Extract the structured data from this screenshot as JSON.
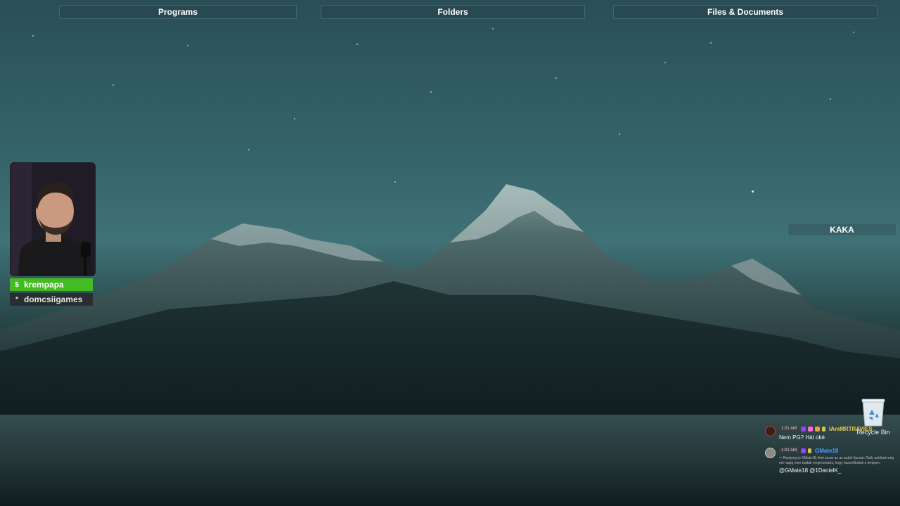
{
  "fences": {
    "programs": "Programs",
    "folders": "Folders",
    "files": "Files & Documents",
    "kaka": "KAKA"
  },
  "stream": {
    "main_streamer": "krempapa",
    "main_icon": "$",
    "co_streamer": "domcsiigames",
    "co_icon": "*",
    "highlight_color": "#44bb22"
  },
  "desktop_icons": {
    "recycle_bin": "Recycle Bin"
  },
  "chat": {
    "messages": [
      {
        "time": "1:01 AM",
        "user": "IAmMRTRAVIES",
        "user_color": "#e8c84a",
        "text": "Nem PG? Hát oké"
      },
      {
        "time": "1:01 AM",
        "user": "GMate18",
        "user_color": "#4aa3ff",
        "reply": "↪ Replying to GMate18: Ami zavar az az autók típusai. Rally autókat még nei napig nem tudták megmondani, hogy hasonlítottak e terepen.",
        "text": "@GMate18 @1DanielK_"
      }
    ]
  }
}
